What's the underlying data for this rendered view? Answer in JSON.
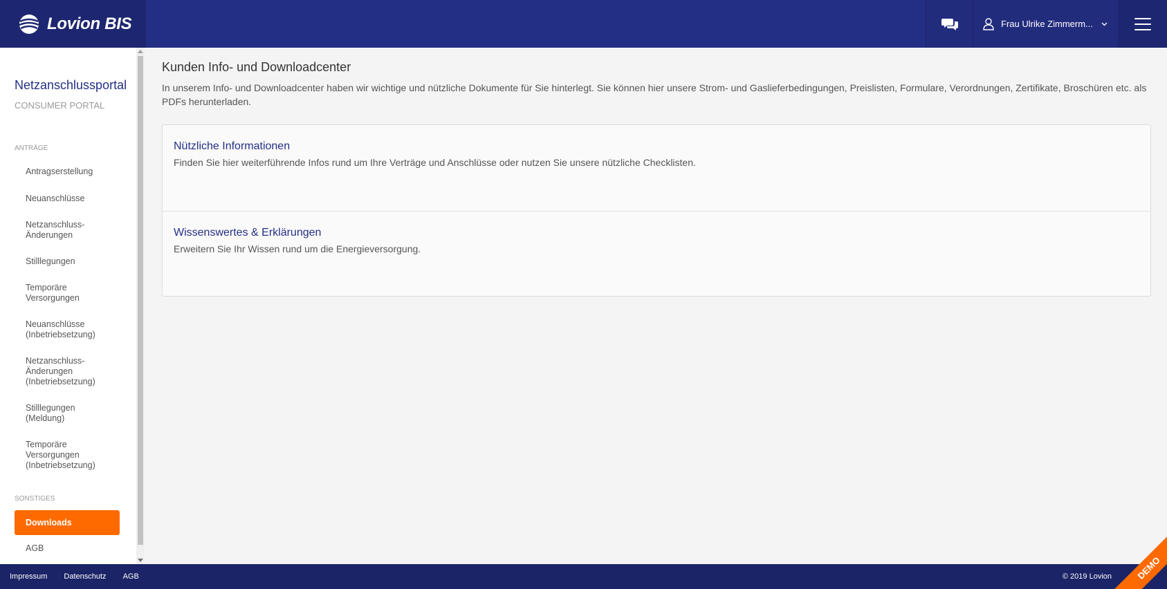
{
  "header": {
    "brand": "Lovion BIS",
    "user_name": "Frau Ulrike Zimmerm...",
    "icons": {
      "brand": "globe-logo-icon",
      "chat": "chat-bubbles-icon",
      "user": "user-icon",
      "dropdown": "chevron-down-icon",
      "menu": "hamburger-menu-icon"
    }
  },
  "sidebar": {
    "title": "Netzanschlussportal",
    "subtitle": "CONSUMER PORTAL",
    "section_antraege": "ANTRÄGE",
    "items_antraege": [
      {
        "label": "Antragserstellung"
      },
      {
        "label": "Neuanschlüsse"
      },
      {
        "label": "Netzanschluss-Änderungen"
      },
      {
        "label": "Stilllegungen"
      },
      {
        "label": "Temporäre Versorgungen"
      },
      {
        "label": "Neuanschlüsse (Inbetriebsetzung)"
      },
      {
        "label": "Netzanschluss-Änderungen (Inbetriebsetzung)"
      },
      {
        "label": "Stilllegungen (Meldung)"
      },
      {
        "label": "Temporäre Versorgungen (Inbetriebsetzung)"
      }
    ],
    "section_sonstiges": "SONSTIGES",
    "items_sonstiges": [
      {
        "label": "Downloads",
        "active": true
      },
      {
        "label": "AGB"
      }
    ]
  },
  "main": {
    "title": "Kunden Info- und Downloadcenter",
    "intro": "In unserem Info- und Downloadcenter haben wir wichtige und nützliche Dokumente für Sie hinterlegt. Sie können hier unsere Strom- und Gaslieferbedingungen, Preislisten, Formulare, Verordnungen, Zertifikate, Broschüren etc. als PDFs herunterladen.",
    "sections": [
      {
        "title": "Nützliche Informationen",
        "text": "Finden Sie hier weiterführende Infos rund um Ihre Verträge und Anschlüsse oder nutzen Sie unsere nützliche Checklisten."
      },
      {
        "title": "Wissenswertes & Erklärungen",
        "text": "Erweitern Sie Ihr Wissen rund um die Energieversorgung."
      }
    ]
  },
  "footer": {
    "links": [
      "Impressum",
      "Datenschutz",
      "AGB"
    ],
    "copyright": "© 2019 Lovion",
    "ribbon": "DEMO"
  },
  "colors": {
    "header": "#232f85",
    "accent": "#ff6a00",
    "footer": "#1b2466"
  }
}
